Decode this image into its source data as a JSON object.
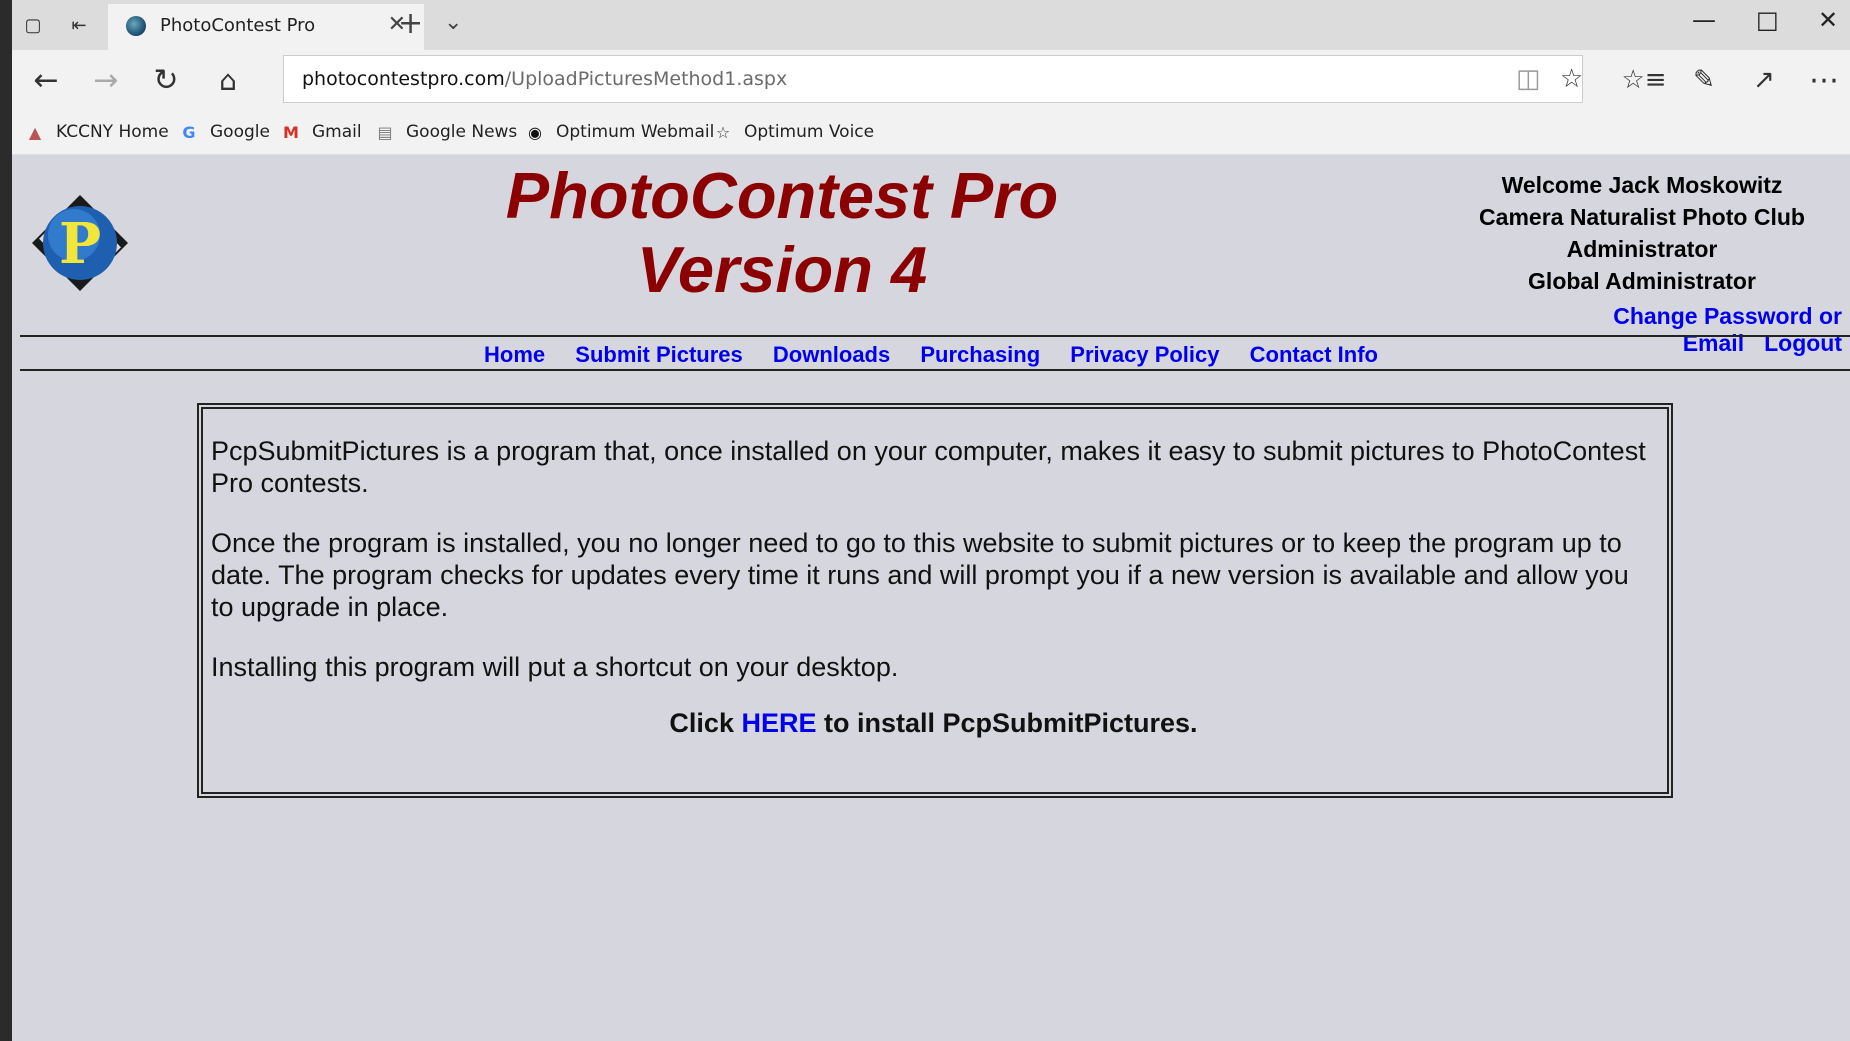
{
  "browser": {
    "tab_title": "PhotoContest Pro",
    "url_host": "photocontestpro.com",
    "url_path": "/UploadPicturesMethod1.aspx",
    "favorites": [
      {
        "label": "KCCNY Home",
        "icon": "kccny-icon"
      },
      {
        "label": "Google",
        "icon": "google-icon"
      },
      {
        "label": "Gmail",
        "icon": "gmail-icon"
      },
      {
        "label": "Google News",
        "icon": "news-icon"
      },
      {
        "label": "Optimum Webmail",
        "icon": "optimum-icon"
      },
      {
        "label": "Optimum Voice",
        "icon": "star-icon"
      }
    ]
  },
  "header": {
    "title_line1": "PhotoContest Pro",
    "title_line2": "Version 4",
    "welcome": "Welcome Jack Moskowitz",
    "club": "Camera Naturalist Photo Club",
    "role1": "Administrator",
    "role2": "Global Administrator",
    "change_password": "Change Password or Email",
    "logout": "Logout",
    "logo_letter": "P"
  },
  "menu": [
    "Home",
    "Submit Pictures",
    "Downloads",
    "Purchasing",
    "Privacy Policy",
    "Contact Info"
  ],
  "content": {
    "para1": "PcpSubmitPictures is a program that, once installed on your computer, makes it easy to submit pictures to PhotoContest Pro contests.",
    "para2": "Once the program is installed, you no longer need to go to this website to submit pictures or to keep the program up to date. The program checks for updates every time it runs and will prompt you if a new version is available and allow you to upgrade in place.",
    "para3": "Installing this program will put a shortcut on your desktop.",
    "install_prefix": "Click ",
    "install_link": "HERE",
    "install_suffix": " to install PcpSubmitPictures."
  }
}
